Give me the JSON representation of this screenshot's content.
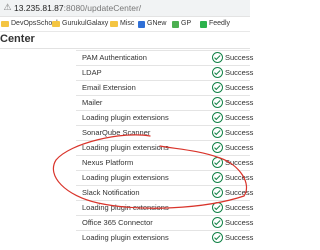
{
  "browser": {
    "url_host": "13.235.81.87",
    "url_path": ":8080/updateCenter/",
    "bookmarks": [
      {
        "label": "DevOpsSchool",
        "kind": "folder"
      },
      {
        "label": "GurukulGalaxy",
        "kind": "folder"
      },
      {
        "label": "Misc",
        "kind": "folder"
      },
      {
        "label": "GNew",
        "kind": "site",
        "color": "#2f6fd6"
      },
      {
        "label": "GP",
        "kind": "site",
        "color": "#4caf50"
      },
      {
        "label": "Feedly",
        "kind": "site",
        "color": "#2bb24c"
      }
    ]
  },
  "page": {
    "title": "Center"
  },
  "plugins": [
    {
      "name": "PAM Authentication",
      "status": "Success"
    },
    {
      "name": "LDAP",
      "status": "Success"
    },
    {
      "name": "Email Extension",
      "status": "Success"
    },
    {
      "name": "Mailer",
      "status": "Success"
    },
    {
      "name": "Loading plugin extensions",
      "status": "Success"
    },
    {
      "name": "SonarQube Scanner",
      "status": "Success"
    },
    {
      "name": "Loading plugin extensions",
      "status": "Success"
    },
    {
      "name": "Nexus Platform",
      "status": "Success"
    },
    {
      "name": "Loading plugin extensions",
      "status": "Success"
    },
    {
      "name": "Slack Notification",
      "status": "Success"
    },
    {
      "name": "Loading plugin extensions",
      "status": "Success"
    },
    {
      "name": "Office 365 Connector",
      "status": "Success"
    },
    {
      "name": "Loading plugin extensions",
      "status": "Success"
    }
  ],
  "colors": {
    "success": "#138347",
    "annotation": "#d9342b"
  }
}
